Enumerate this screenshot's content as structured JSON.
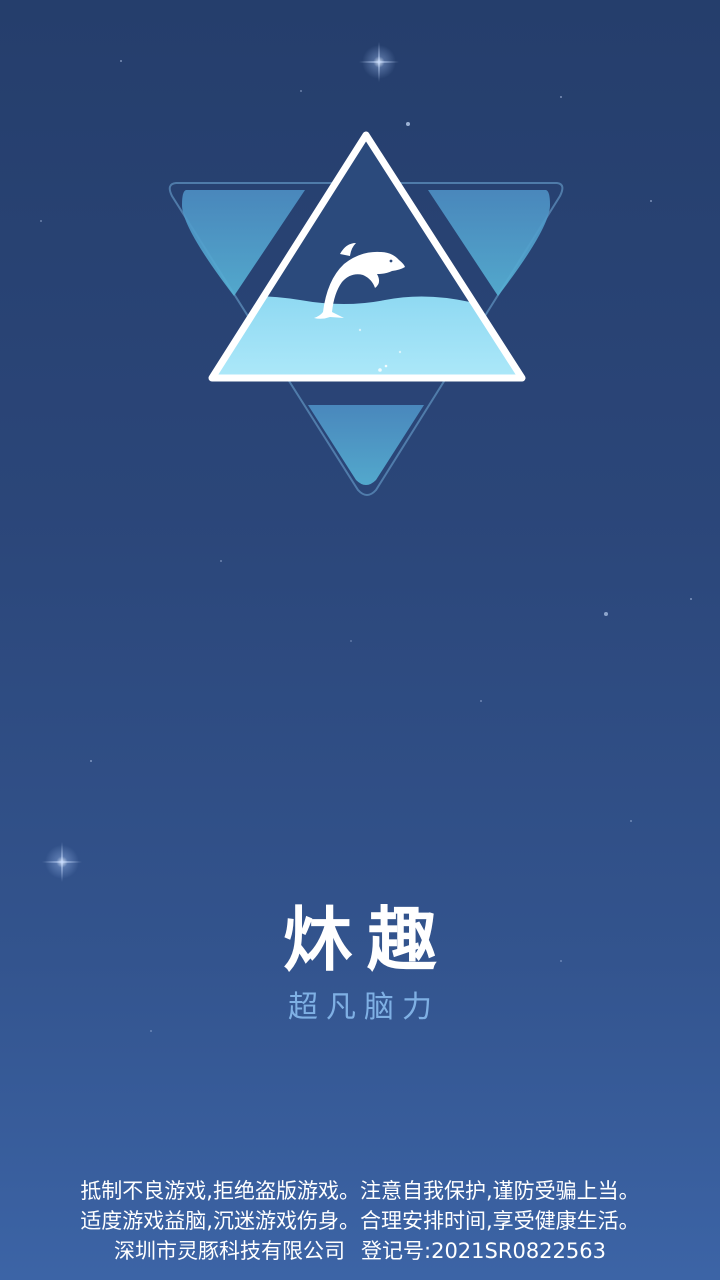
{
  "app": {
    "brand_name": "炑趣",
    "slogan": "超凡脑力"
  },
  "notice": {
    "line1": "抵制不良游戏,拒绝盗版游戏。注意自我保护,谨防受骗上当。",
    "line2": "适度游戏益脑,沉迷游戏伤身。合理安排时间,享受健康生活。"
  },
  "company": {
    "name": "深圳市灵豚科技有限公司",
    "registration": "登记号:2021SR0822563"
  },
  "icons": {
    "logo": "dolphin-triangle-logo-icon"
  },
  "colors": {
    "background_top": "#253e6c",
    "background_bottom": "#3c64a6",
    "slogan": "#7fb0e4",
    "water": "#8fd9f2"
  }
}
